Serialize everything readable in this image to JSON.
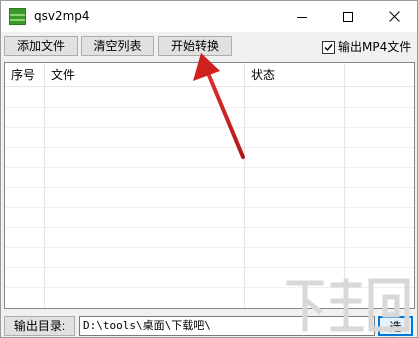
{
  "window": {
    "title": "qsv2mp4",
    "icon": "qsv-mp4-app-icon",
    "controls": [
      "minimize-icon",
      "maximize-icon",
      "close-icon"
    ]
  },
  "toolbar": {
    "add_file_label": "添加文件",
    "clear_list_label": "清空列表",
    "start_convert_label": "开始转换",
    "output_mp4_label": "输出MP4文件",
    "output_mp4_checked": true
  },
  "list": {
    "columns": [
      "序号",
      "文件",
      "状态"
    ],
    "rows": []
  },
  "bottom": {
    "output_dir_label": "输出目录:",
    "output_dir_value": "D:\\tools\\桌面\\下载吧\\",
    "select_label": "选择"
  },
  "colors": {
    "window_bg": "#f0f0f0",
    "button_bg": "#e1e1e1",
    "focus_border": "#0078d7",
    "annotation_arrow": "#cc2222",
    "app_icon": "#3a9a2a"
  }
}
